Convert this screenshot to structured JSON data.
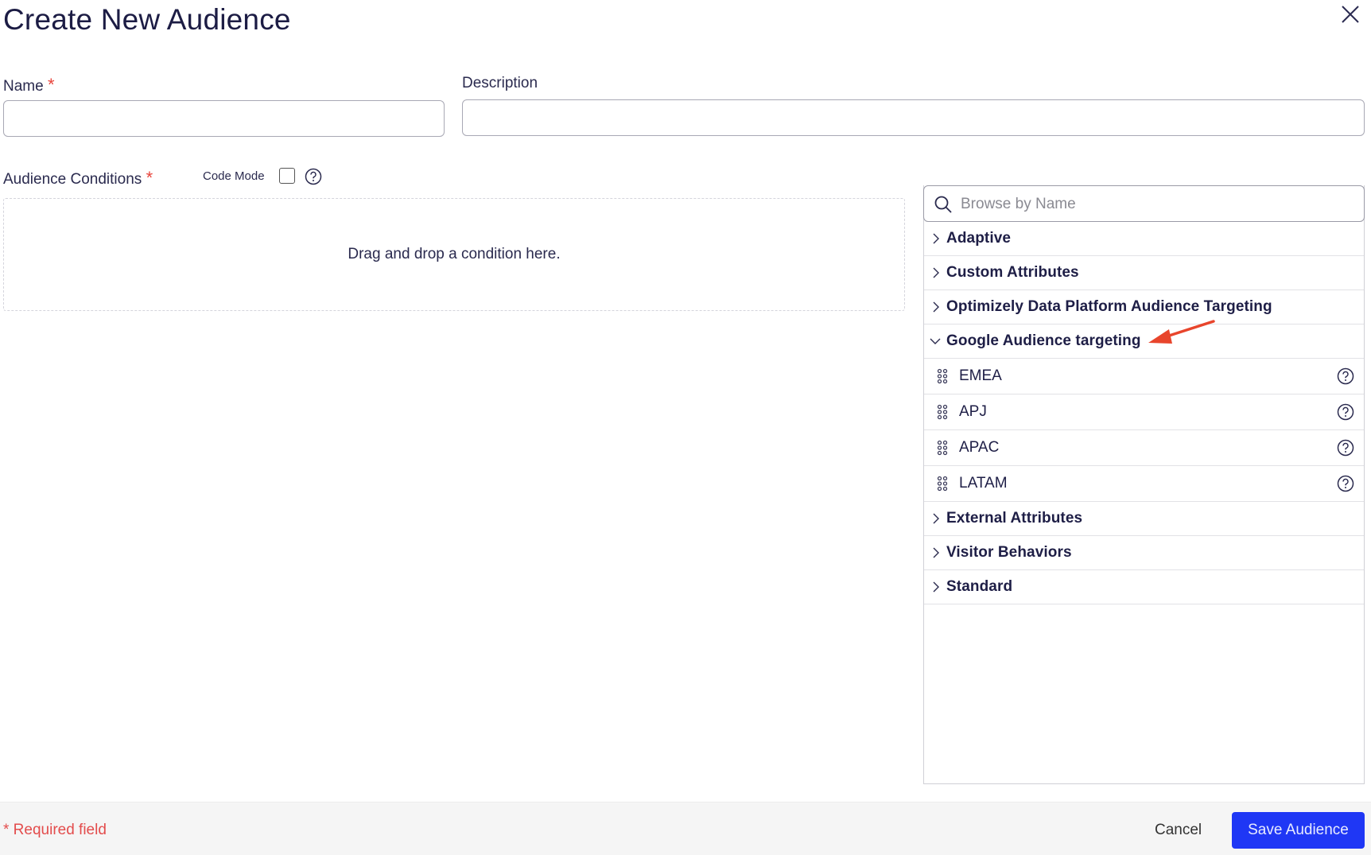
{
  "header": {
    "title": "Create New Audience",
    "close_icon": "close-icon"
  },
  "form": {
    "name": {
      "label": "Name",
      "required_mark": "*",
      "value": "",
      "placeholder": ""
    },
    "description": {
      "label": "Description",
      "value": "",
      "placeholder": ""
    }
  },
  "conditions": {
    "label": "Audience Conditions",
    "required_mark": "*",
    "code_mode_label": "Code Mode",
    "code_mode_checked": false,
    "help_icon": "help-circle-icon",
    "dropzone_text": "Drag and drop a condition here."
  },
  "browser": {
    "search_placeholder": "Browse by Name",
    "search_value": "",
    "categories": [
      {
        "label": "Adaptive",
        "expanded": false
      },
      {
        "label": "Custom Attributes",
        "expanded": false
      },
      {
        "label": "Optimizely Data Platform Audience Targeting",
        "expanded": false
      },
      {
        "label": "Google Audience targeting",
        "expanded": true,
        "annotated": true,
        "items": [
          {
            "label": "EMEA"
          },
          {
            "label": "APJ"
          },
          {
            "label": "APAC"
          },
          {
            "label": "LATAM"
          }
        ]
      },
      {
        "label": "External Attributes",
        "expanded": false
      },
      {
        "label": "Visitor Behaviors",
        "expanded": false
      },
      {
        "label": "Standard",
        "expanded": false
      }
    ]
  },
  "annotation": {
    "type": "arrow",
    "color": "#e8452c",
    "points_to": "Google Audience targeting"
  },
  "footer": {
    "required_note": "* Required field",
    "cancel_label": "Cancel",
    "save_label": "Save Audience"
  },
  "colors": {
    "primary": "#1f37f5",
    "required": "#e8453c",
    "text": "#1e1e46",
    "footer_bg": "#f5f5f5"
  }
}
